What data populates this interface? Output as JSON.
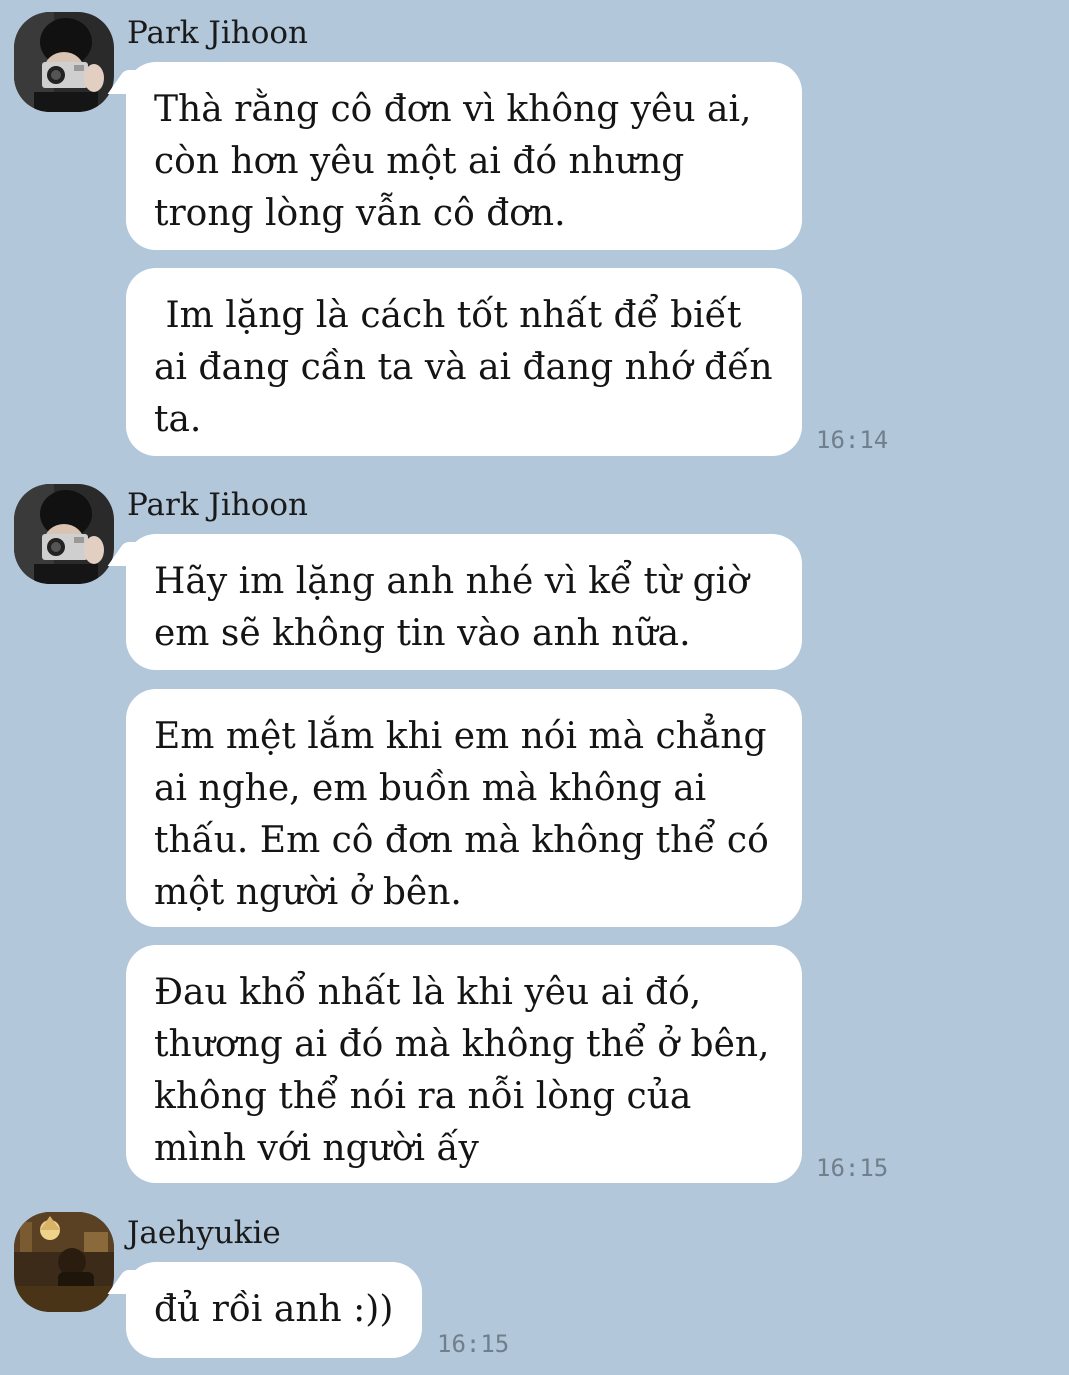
{
  "groups": [
    {
      "sender": "Park Jihoon",
      "avatar_icon": "profile-photo-camera-icon",
      "messages": [
        "Thà rằng cô đơn vì không yêu ai, còn hơn yêu một ai đó nhưng trong lòng vẫn cô đơn.",
        " Im lặng là cách tốt nhất để biết ai đang cần ta và ai đang nhớ đến ta."
      ],
      "time": "16:14"
    },
    {
      "sender": "Park Jihoon",
      "avatar_icon": "profile-photo-camera-icon",
      "messages": [
        "Hãy im lặng anh nhé vì kể từ giờ em sẽ không tin vào anh nữa.",
        "Em mệt lắm khi em nói mà chẳng ai nghe, em buồn mà không ai thấu. Em cô đơn mà không thể có một người ở bên.",
        "Đau khổ nhất là khi yêu ai đó, thương ai đó mà không thể ở bên, không thể nói ra nỗi lòng của mình với người ấy"
      ],
      "time": "16:15"
    },
    {
      "sender": "Jaehyukie",
      "avatar_icon": "profile-photo-lamp-icon",
      "messages": [
        "đủ rồi anh :))"
      ],
      "time": "16:15"
    }
  ],
  "colors": {
    "background": "#b2c7da",
    "bubble": "#ffffff",
    "timestamp": "#6f7f8c"
  }
}
